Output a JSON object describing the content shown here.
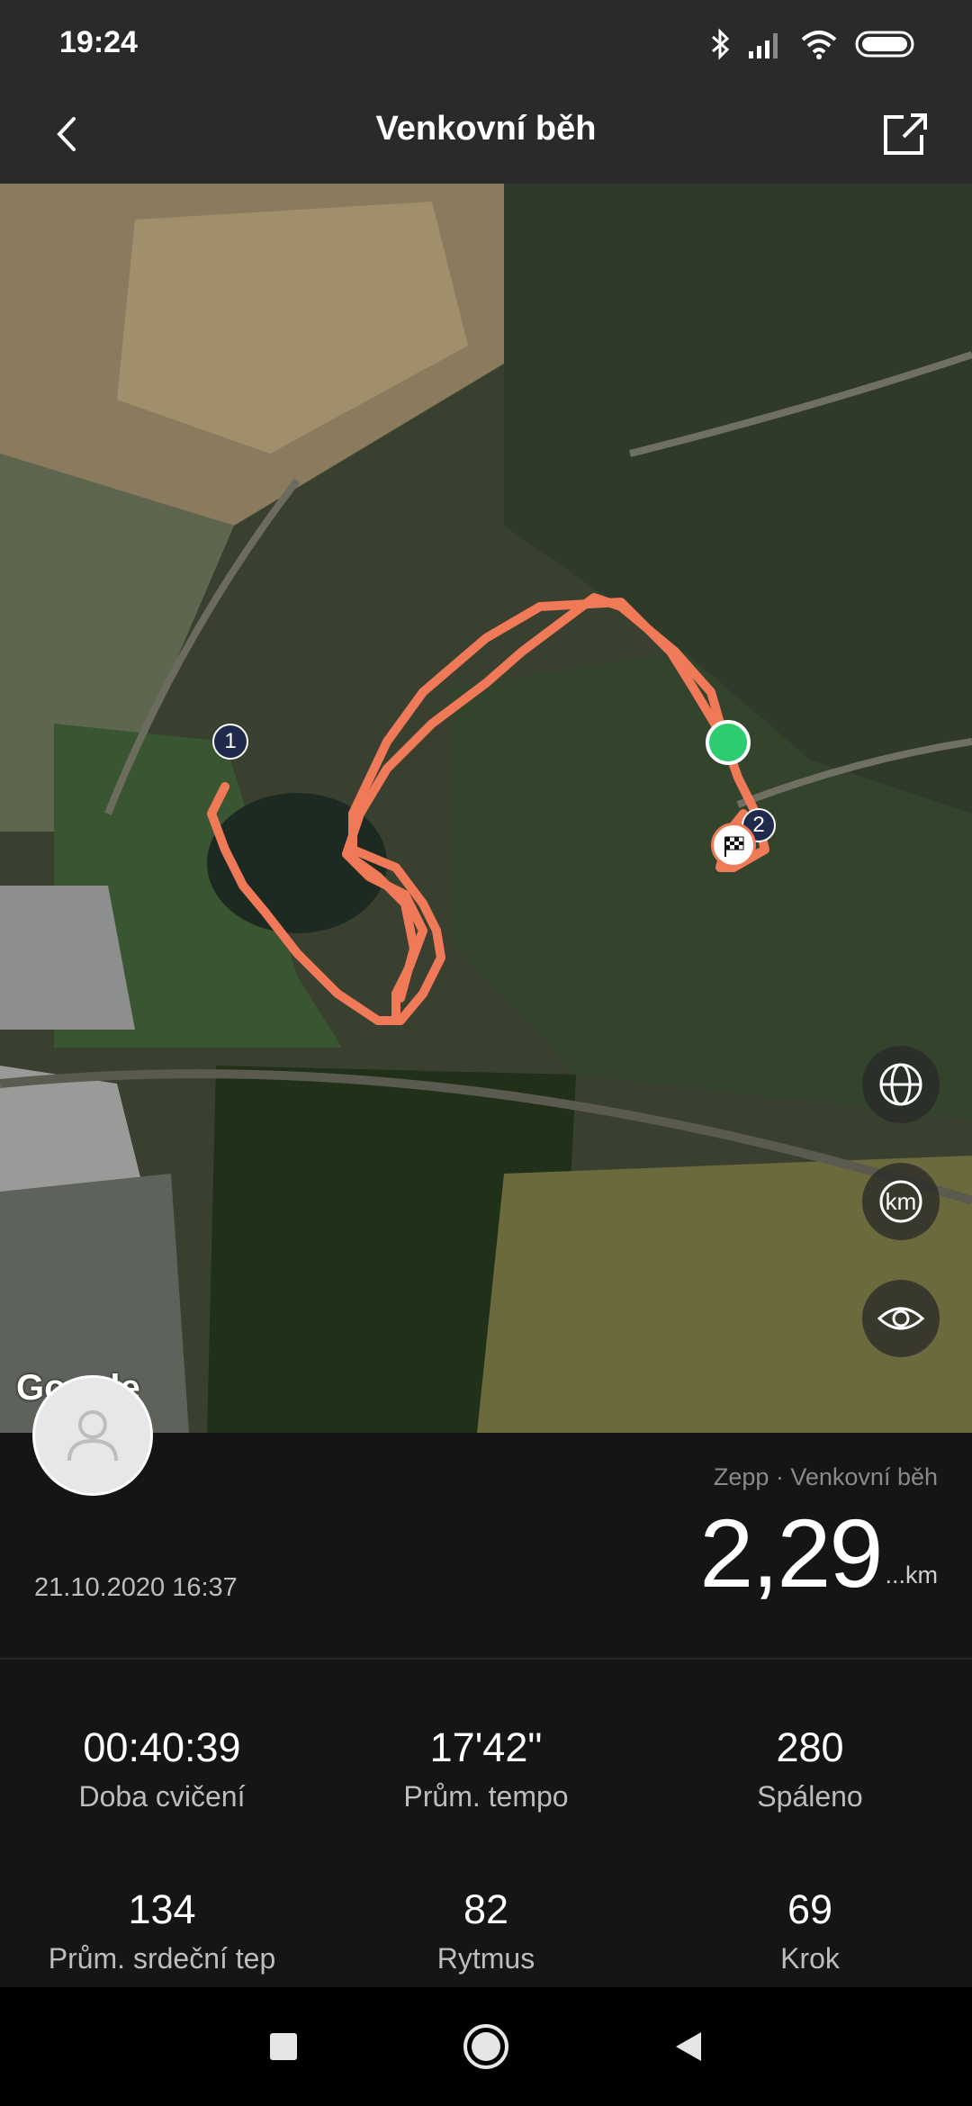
{
  "status_bar": {
    "time": "19:24"
  },
  "header": {
    "title": "Venkovní běh"
  },
  "map": {
    "google_label": "Google",
    "marker_start_label": "1",
    "marker_end_label": "2",
    "route_color": "#f07a58",
    "start_color": "#2ecc71",
    "buttons": [
      "globe-icon",
      "km-icon",
      "eye-icon"
    ],
    "km_label": "km"
  },
  "summary": {
    "source": "Zepp · Venkovní běh",
    "distance": "2,29",
    "distance_unit": "...km",
    "datetime": "21.10.2020 16:37"
  },
  "stats": [
    {
      "value": "00:40:39",
      "label": "Doba cvičení"
    },
    {
      "value": "17'42\"",
      "label": "Prům. tempo"
    },
    {
      "value": "280",
      "label": "Spáleno"
    },
    {
      "value": "134",
      "label": "Prům. srdeční tep"
    },
    {
      "value": "82",
      "label": "Rytmus"
    },
    {
      "value": "69",
      "label": "Krok"
    }
  ]
}
